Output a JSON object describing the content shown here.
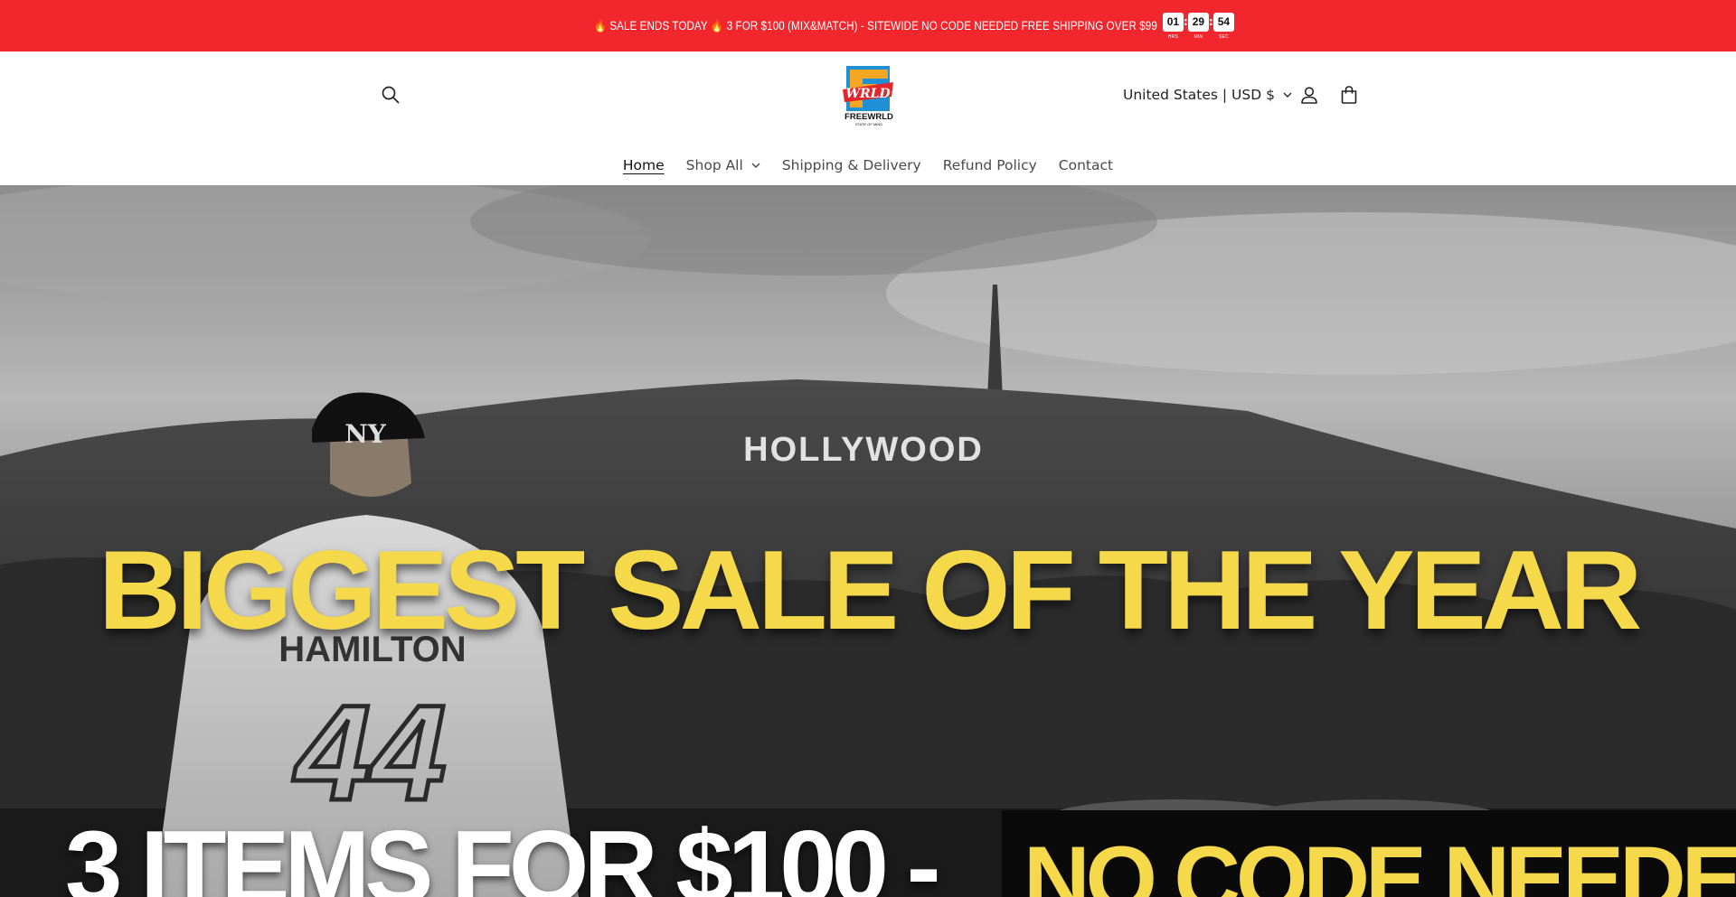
{
  "announcement": {
    "text": "🔥 SALE ENDS TODAY 🔥 3 FOR $100 (MIX&MATCH) - SITEWIDE NO CODE NEEDED FREE SHIPPING OVER $99",
    "timer": {
      "hours": "01",
      "hours_unit": "HRS",
      "minutes": "29",
      "minutes_unit": "MIN",
      "seconds": "54",
      "seconds_unit": "SEC"
    }
  },
  "header": {
    "logo_text": "FREEWRLD",
    "logo_letter": "F",
    "logo_script": "WRLD",
    "logo_tagline": "STATE OF MIND",
    "country_selector": "United States | USD $",
    "icons": [
      "search-icon",
      "account-icon",
      "cart-icon"
    ]
  },
  "nav": {
    "items": [
      {
        "label": "Home",
        "active": true
      },
      {
        "label": "Shop All",
        "has_dropdown": true
      },
      {
        "label": "Shipping & Delivery"
      },
      {
        "label": "Refund Policy"
      },
      {
        "label": "Contact"
      }
    ]
  },
  "hero": {
    "sign_text": "HOLLYWOOD",
    "jersey_name": "HAMILTON",
    "jersey_number": "44",
    "cap_logo": "NY",
    "headline": "BIGGEST SALE OF THE YEAR",
    "offer": "3 ITEMS FOR $100 -",
    "no_code": "NO CODE NEEDED",
    "colors": {
      "headline": "#f5d94a",
      "banner_red": "#f2262d"
    }
  }
}
